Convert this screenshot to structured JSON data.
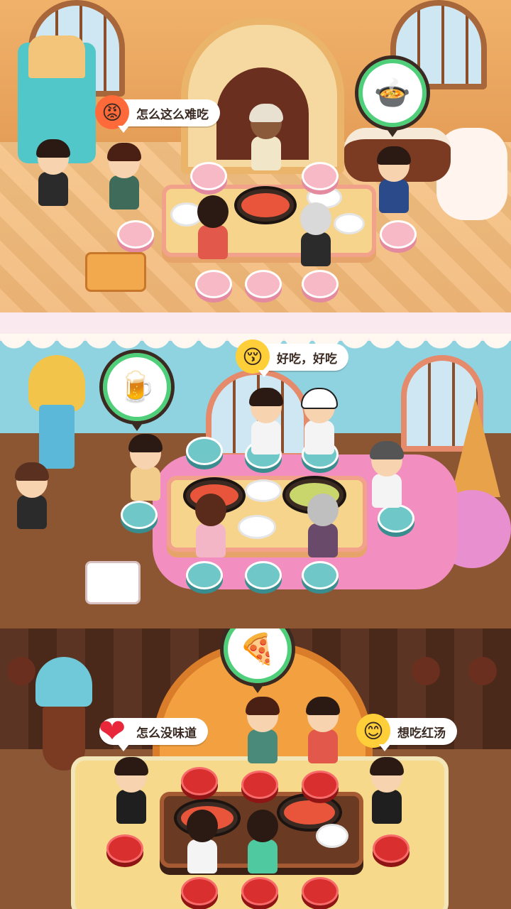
{
  "floors": [
    {
      "theme": "bread-bakery",
      "bubbles": [
        {
          "emotion": "angry-face-icon",
          "text": "怎么这么难吃"
        }
      ],
      "order_icon": "seafood-bowl-icon"
    },
    {
      "theme": "candy-icecream",
      "bubbles": [
        {
          "emotion": "kissing-face-icon",
          "text": "好吃，好吃"
        }
      ],
      "order_icon": "beer-mug-icon"
    },
    {
      "theme": "chocolate-cake",
      "bubbles": [
        {
          "emotion": "heart-icon",
          "text": "怎么没味道"
        },
        {
          "emotion": "smiling-face-icon",
          "text": "想吃红汤"
        }
      ],
      "order_icon": "pizza-icon"
    }
  ],
  "colors": {
    "bubble_bg": "#ffffff",
    "bubble_text": "#3a2a22",
    "order_ring": "#4fcf7a",
    "angry": "#ff6a3a",
    "happy": "#ffcf3a",
    "heart": "#e8283a"
  }
}
